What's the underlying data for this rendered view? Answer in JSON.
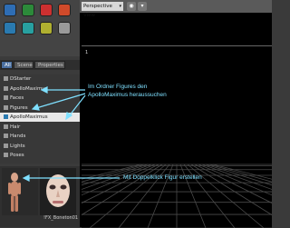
{
  "app": {
    "accent": "#4a6fa0",
    "annotation_color": "#7fe0ff"
  },
  "toolbar": {
    "tools": [
      {
        "icon": "globe-tool-icon",
        "color": "#2e6db4"
      },
      {
        "icon": "move-tool-icon",
        "color": "#2c8a3a"
      },
      {
        "icon": "rotate-tool-icon",
        "color": "#cc3030"
      },
      {
        "icon": "scale-tool-icon",
        "color": "#d04a2a"
      },
      {
        "icon": "zoom-tool-icon",
        "color": "#2a7ab0"
      },
      {
        "icon": "pan-tool-icon",
        "color": "#28a0a0"
      },
      {
        "icon": "morph-tool-icon",
        "color": "#b0b030"
      },
      {
        "icon": "grab-tool-icon",
        "color": "#9a9a9a"
      }
    ]
  },
  "tabs": [
    {
      "label": "All",
      "active": true
    },
    {
      "label": "Scene",
      "active": false
    },
    {
      "label": "Properties",
      "active": false
    }
  ],
  "tree": {
    "items": [
      {
        "label": "DStarter",
        "selected": false
      },
      {
        "label": "ApolloMaximus",
        "selected": false
      },
      {
        "label": "Faces",
        "selected": false
      },
      {
        "label": "Figures",
        "selected": false
      },
      {
        "label": "ApolloMaximus",
        "selected": true
      },
      {
        "label": "Hair",
        "selected": false
      },
      {
        "label": "Hands",
        "selected": false
      },
      {
        "label": "Lights",
        "selected": false
      },
      {
        "label": "Poses",
        "selected": false
      }
    ]
  },
  "thumbnails": [
    {
      "label": "",
      "kind": "figure-preview"
    },
    {
      "label": "!FX_Boneton01",
      "kind": "face-preview"
    }
  ],
  "viewport": {
    "view_label": "Perspective View",
    "corner_marker": "1"
  },
  "annotations": {
    "folder_hint_line1": "Im Ordner Figures den",
    "folder_hint_line2": "ApolloMaximus heraussuchen",
    "doubleclick_hint": "Mit Doppelklick Figur erstellen"
  }
}
